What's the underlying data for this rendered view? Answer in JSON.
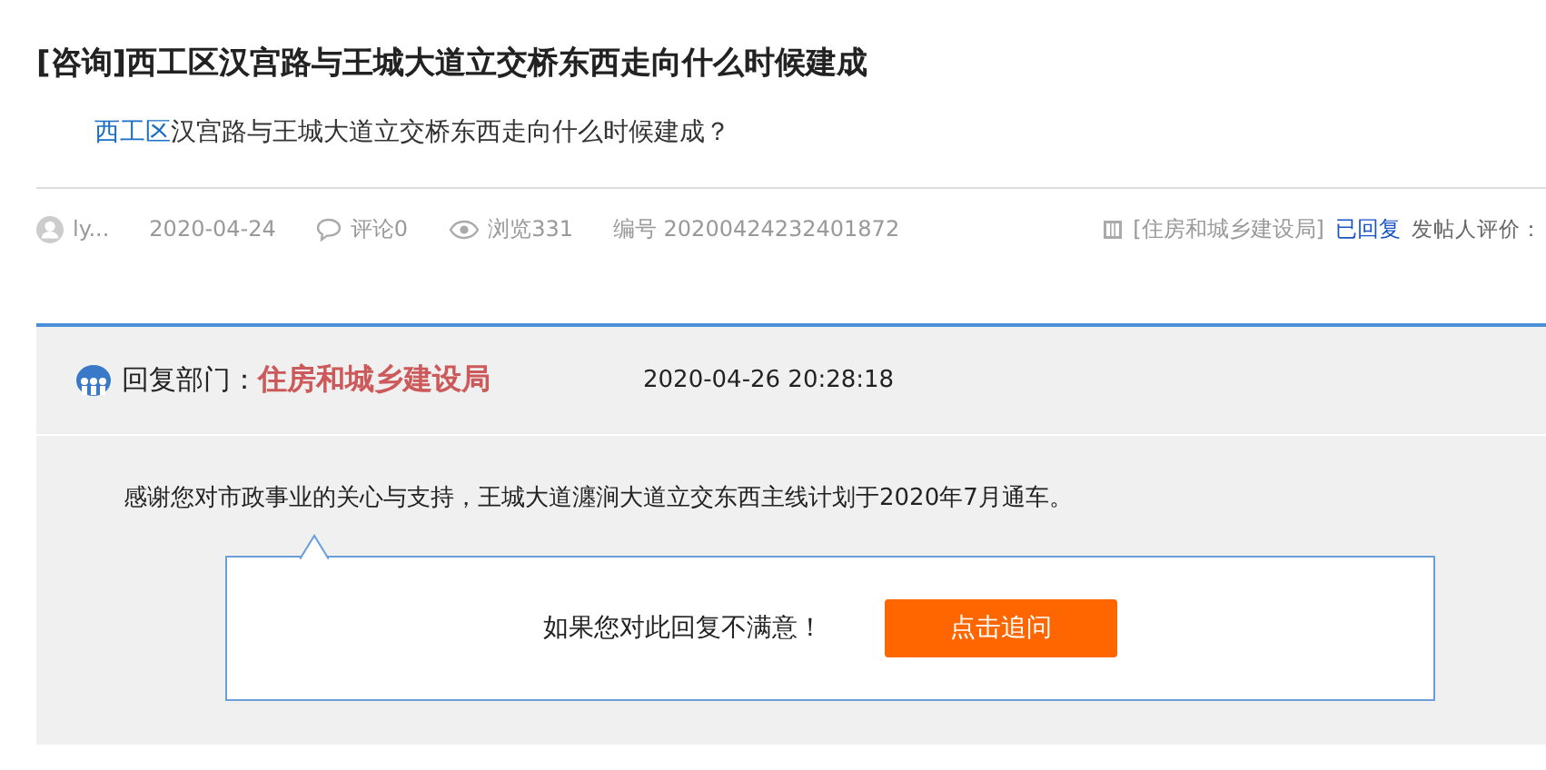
{
  "post": {
    "category": "[咨询]",
    "title": "西工区汉宫路与王城大道立交桥东西走向什么时候建成",
    "body_link": "西工区",
    "body_text": "汉宫路与王城大道立交桥东西走向什么时候建成？"
  },
  "meta": {
    "author": "ly...",
    "date": "2020-04-24",
    "comments": "评论0",
    "views": "浏览331",
    "number": "编号 20200424232401872",
    "department": "[住房和城乡建设局]",
    "status": "已回复",
    "rating_label": "发帖人评价："
  },
  "reply": {
    "label": "回复部门：",
    "department": "住房和城乡建设局",
    "time": "2020-04-26 20:28:18",
    "text": "感谢您对市政事业的关心与支持，王城大道瀍涧大道立交东西主线计划于2020年7月通车。",
    "prompt": "如果您对此回复不满意！",
    "button": "点击追问"
  }
}
